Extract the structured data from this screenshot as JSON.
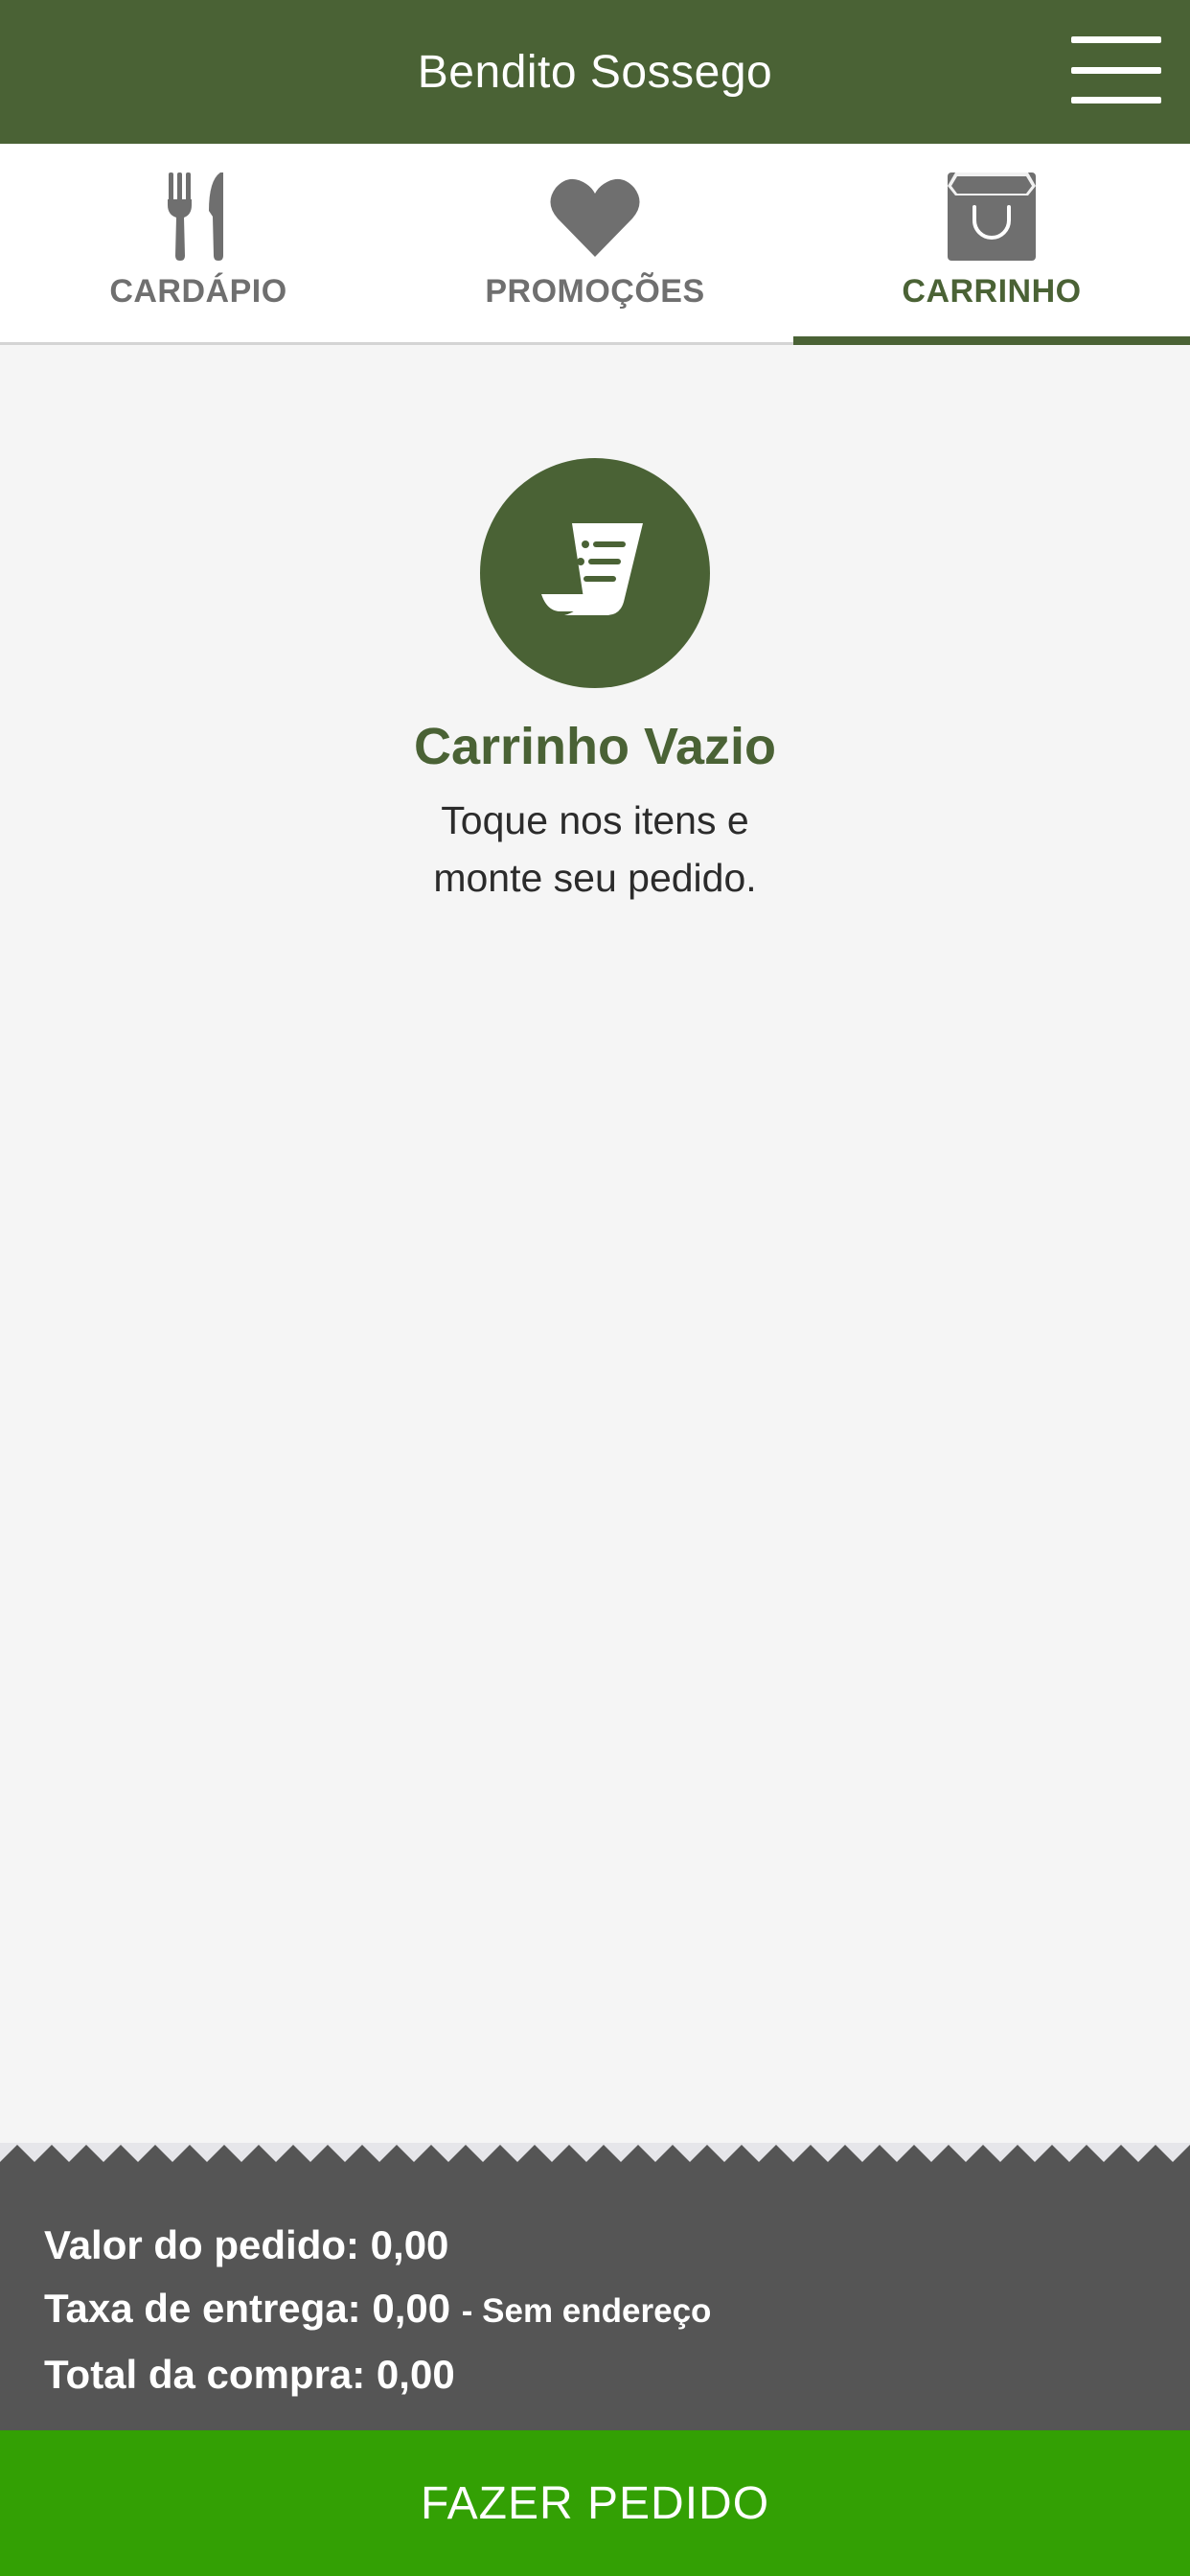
{
  "header": {
    "title": "Bendito Sossego",
    "menu_icon": "hamburger-menu-icon"
  },
  "tabs": [
    {
      "label": "CARDÁPIO",
      "icon": "fork-knife-icon",
      "active": false
    },
    {
      "label": "PROMOÇÕES",
      "icon": "heart-icon",
      "active": false
    },
    {
      "label": "CARRINHO",
      "icon": "shopping-bag-icon",
      "active": true
    }
  ],
  "empty_state": {
    "icon": "receipt-icon",
    "title": "Carrinho Vazio",
    "message_line1": "Toque nos itens e",
    "message_line2": "monte seu pedido."
  },
  "summary": {
    "order_value": "Valor do pedido: 0,00",
    "delivery_fee": "Taxa de entrega: 0,00",
    "delivery_note": "- Sem endereço",
    "total": "Total da compra: 0,00"
  },
  "order_button": {
    "label": "FAZER PEDIDO"
  },
  "colors": {
    "brand_green": "#4a6235",
    "tab_inactive": "#6f6f6f",
    "summary_bg": "#555555",
    "order_button_bg": "#33a004",
    "page_bg": "#f5f5f5"
  }
}
